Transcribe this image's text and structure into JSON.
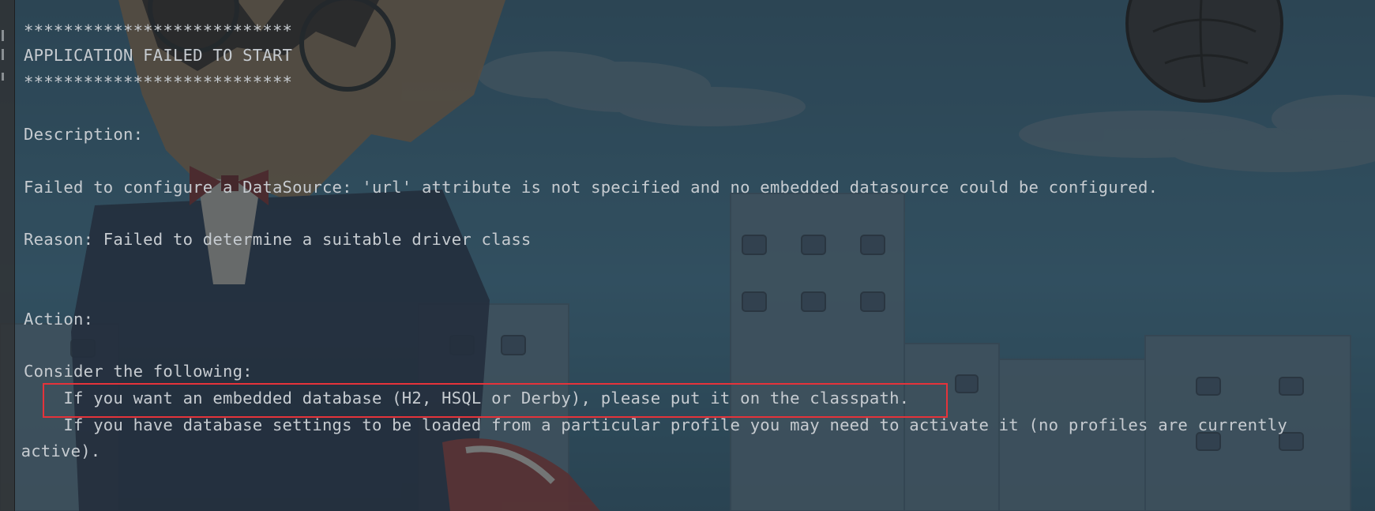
{
  "console": {
    "lines": [
      "***************************",
      "APPLICATION FAILED TO START",
      "***************************",
      "Description:",
      "Failed to configure a DataSource: 'url' attribute is not specified and no embedded datasource could be configured.",
      "Reason: Failed to determine a suitable driver class",
      "Action:",
      "Consider the following:",
      "    If you want an embedded database (H2, HSQL or Derby), please put it on the classpath.",
      "    If you have database settings to be loaded from a particular profile you may need to activate it (no profiles are currently",
      " active)."
    ]
  },
  "colors": {
    "text": "#c6cbd0",
    "highlight_border": "#e5333a",
    "sky": "#3d6f8d",
    "gutter": "#303235"
  },
  "background": {
    "icon": "anime-wallpaper-illustration"
  }
}
